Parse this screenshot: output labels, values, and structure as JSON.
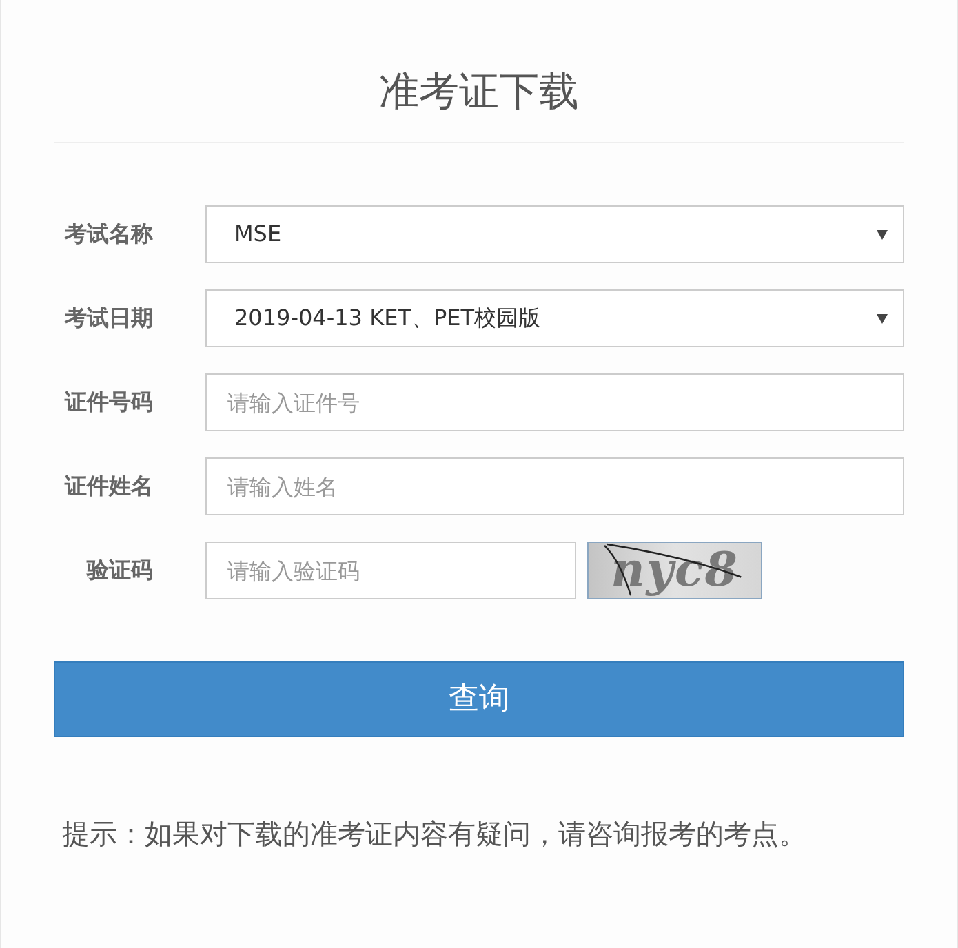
{
  "title": "准考证下载",
  "form": {
    "fields": [
      {
        "kind": "select",
        "label": "考试名称",
        "value": "MSE"
      },
      {
        "kind": "select",
        "label": "考试日期",
        "value": "2019-04-13 KET、PET校园版"
      },
      {
        "kind": "input",
        "label": "证件号码",
        "placeholder": "请输入证件号"
      },
      {
        "kind": "input",
        "label": "证件姓名",
        "placeholder": "请输入姓名"
      },
      {
        "kind": "captcha",
        "label": "验证码",
        "placeholder": "请输入验证码",
        "captcha_code": "nyc8"
      }
    ]
  },
  "submit_button": "查询",
  "tip": "提示：如果对下载的准考证内容有疑问，请咨询报考的考点。"
}
